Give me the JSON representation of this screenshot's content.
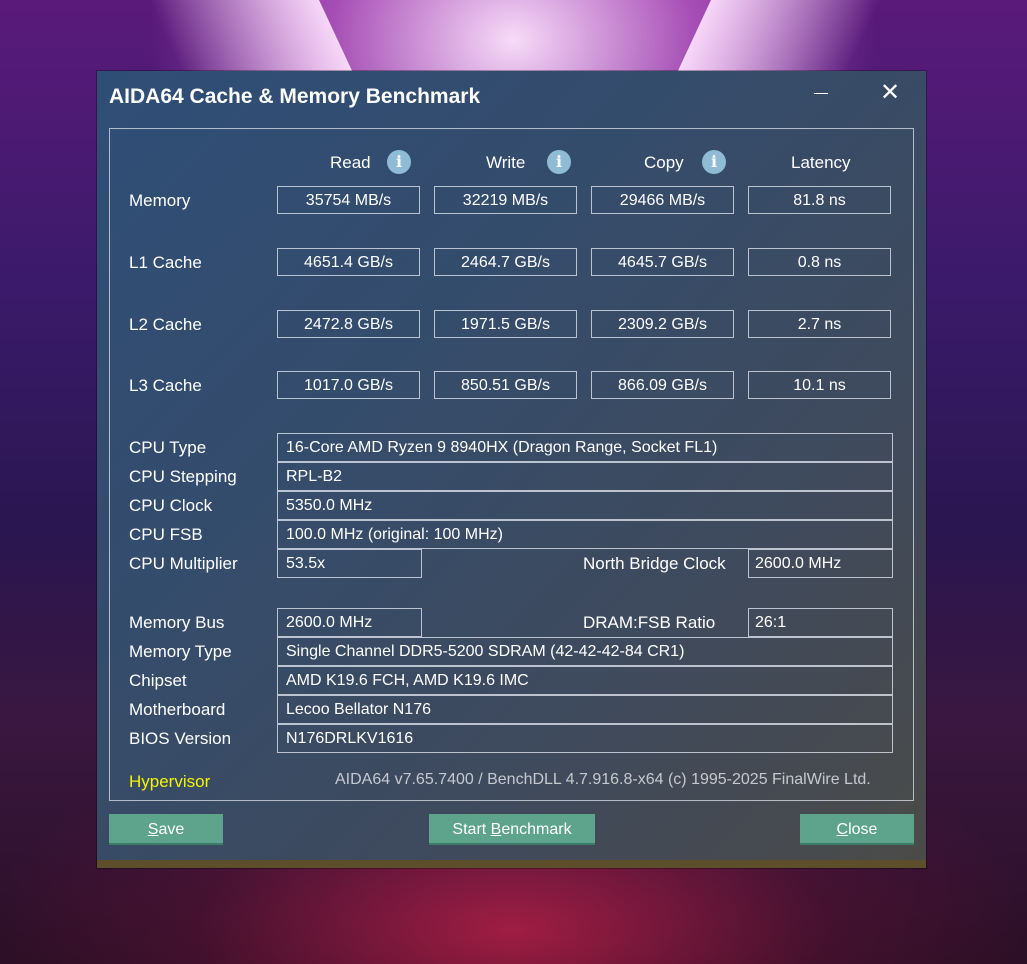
{
  "window": {
    "title": "AIDA64 Cache & Memory Benchmark",
    "close_glyph": "✕"
  },
  "columns": [
    {
      "label": "Read",
      "info": "i"
    },
    {
      "label": "Write",
      "info": "i"
    },
    {
      "label": "Copy",
      "info": "i"
    },
    {
      "label": "Latency"
    }
  ],
  "results": [
    {
      "label": "Memory",
      "values": [
        "35754 MB/s",
        "32219 MB/s",
        "29466 MB/s",
        "81.8 ns"
      ]
    },
    {
      "label": "L1 Cache",
      "values": [
        "4651.4 GB/s",
        "2464.7 GB/s",
        "4645.7 GB/s",
        "0.8 ns"
      ]
    },
    {
      "label": "L2 Cache",
      "values": [
        "2472.8 GB/s",
        "1971.5 GB/s",
        "2309.2 GB/s",
        "2.7 ns"
      ]
    },
    {
      "label": "L3 Cache",
      "values": [
        "1017.0 GB/s",
        "850.51 GB/s",
        "866.09 GB/s",
        "10.1 ns"
      ]
    }
  ],
  "cpu": {
    "type_label": "CPU Type",
    "type": "16-Core AMD Ryzen 9 8940HX  (Dragon Range, Socket FL1)",
    "stepping_label": "CPU Stepping",
    "stepping": "RPL-B2",
    "clock_label": "CPU Clock",
    "clock": "5350.0 MHz",
    "fsb_label": "CPU FSB",
    "fsb": "100.0 MHz  (original: 100 MHz)",
    "multiplier_label": "CPU Multiplier",
    "multiplier": "53.5x",
    "nb_clock_label": "North Bridge Clock",
    "nb_clock": "2600.0 MHz"
  },
  "memory": {
    "bus_label": "Memory Bus",
    "bus": "2600.0 MHz",
    "ratio_label": "DRAM:FSB Ratio",
    "ratio": "26:1",
    "type_label": "Memory Type",
    "type": "Single Channel DDR5-5200 SDRAM  (42-42-42-84 CR1)",
    "chipset_label": "Chipset",
    "chipset": "AMD K19.6 FCH, AMD K19.6 IMC",
    "board_label": "Motherboard",
    "board": "Lecoo Bellator N176",
    "bios_label": "BIOS Version",
    "bios": "N176DRLKV1616"
  },
  "status": {
    "hypervisor": "Hypervisor",
    "version": "AIDA64 v7.65.7400 / BenchDLL 4.7.916.8-x64  (c) 1995-2025 FinalWire Ltd."
  },
  "buttons": {
    "save_u": "S",
    "save_rest": "ave",
    "start_a": "Start ",
    "start_u": "B",
    "start_rest": "enchmark",
    "close_u": "C",
    "close_rest": "lose"
  },
  "colors": {
    "hypervisor": "#f4f400",
    "button": "#5ea48d"
  }
}
